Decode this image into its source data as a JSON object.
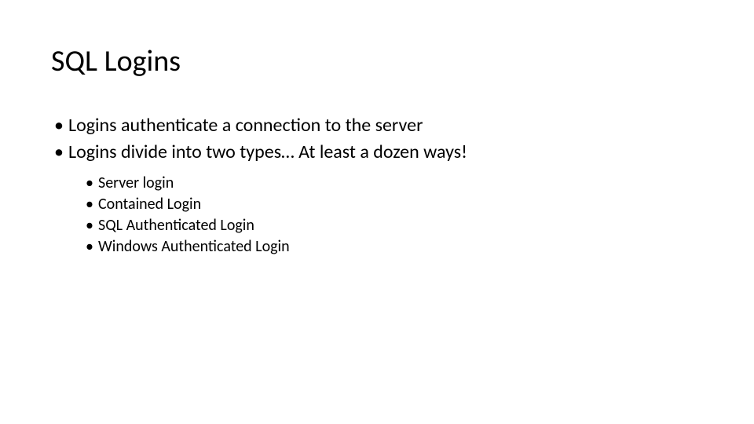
{
  "title": "SQL Logins",
  "bullets": [
    "Logins authenticate a connection to the server",
    "Logins divide into two types… At least a dozen ways!"
  ],
  "sub_bullets": [
    "Server login",
    "Contained Login",
    "SQL Authenticated Login",
    "Windows Authenticated Login"
  ]
}
